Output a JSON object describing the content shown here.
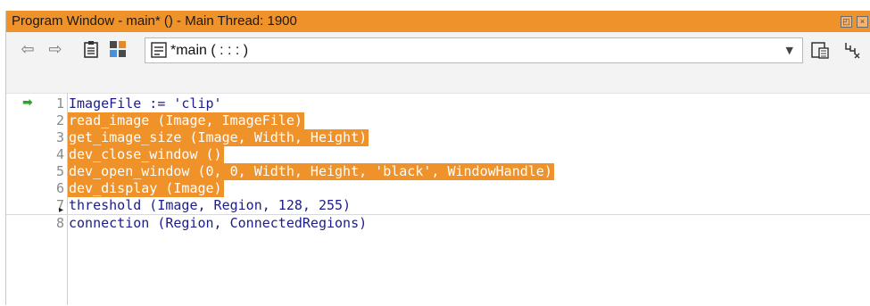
{
  "window": {
    "title": "Program Window - main* () - Main Thread: 1900",
    "restore_icon": "restore-icon",
    "close_icon": "close-icon"
  },
  "toolbar": {
    "back_icon": "arrow-left-icon",
    "forward_icon": "arrow-right-icon",
    "clipboard_icon": "clipboard-icon",
    "grid_icon": "grid-icon",
    "procedure_icon": "procedure-icon",
    "procedure": "*main ( : : : )",
    "dropdown_icon": "chevron-down-icon",
    "calc_icon": "calculator-icon",
    "variable_icon": "variable-icon"
  },
  "editor": {
    "lines": [
      {
        "num": "1",
        "code": "ImageFile := 'clip'",
        "selected": false
      },
      {
        "num": "2",
        "code": "read_image (Image, ImageFile)",
        "selected": true
      },
      {
        "num": "3",
        "code": "get_image_size (Image, Width, Height)",
        "selected": true
      },
      {
        "num": "4",
        "code": "dev_close_window ()",
        "selected": true
      },
      {
        "num": "5",
        "code": "dev_open_window (0, 0, Width, Height, 'black', WindowHandle)",
        "selected": true
      },
      {
        "num": "6",
        "code": "dev_display (Image)",
        "selected": true
      },
      {
        "num": "7",
        "code": "threshold (Image, Region, 128, 255)",
        "selected": false
      },
      {
        "num": "8",
        "code": "connection (Region, ConnectedRegions)",
        "selected": false
      }
    ],
    "pc_marker_icon": "program-counter-arrow-icon",
    "colors": {
      "selection": "#f0922a",
      "code": "#1c1c8c",
      "title_bar": "#f0922a"
    }
  }
}
